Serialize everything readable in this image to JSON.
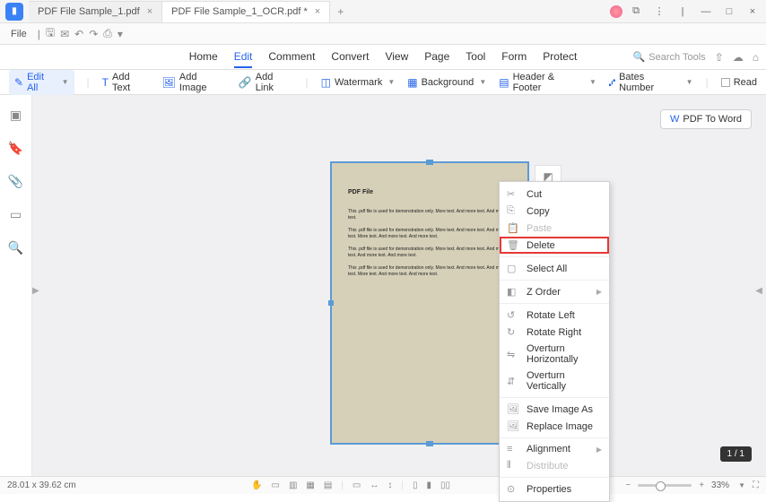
{
  "titlebar": {
    "tabs": [
      {
        "label": "PDF File Sample_1.pdf"
      },
      {
        "label": "PDF File Sample_1_OCR.pdf *"
      }
    ]
  },
  "toolbar1": {
    "file": "File"
  },
  "menubar": {
    "items": [
      "Home",
      "Edit",
      "Comment",
      "Convert",
      "View",
      "Page",
      "Tool",
      "Form",
      "Protect"
    ],
    "search_placeholder": "Search Tools"
  },
  "ribbon": {
    "edit_all": "Edit All",
    "add_text": "Add Text",
    "add_image": "Add Image",
    "add_link": "Add Link",
    "watermark": "Watermark",
    "background": "Background",
    "header_footer": "Header & Footer",
    "bates_number": "Bates Number",
    "read": "Read"
  },
  "canvas": {
    "pdf_to_word": "PDF To Word",
    "page_indicator": "1 / 1"
  },
  "page": {
    "title": "PDF File",
    "p1": "This .pdf file is used for demonstration only. More text. And more text. And more text.",
    "p2": "This .pdf file is used for demonstration only. More text. And more text. And more text. More text. And more text. And more text.",
    "p3": "This .pdf file is used for demonstration only. More text. And more text. And more text. And more text. And more text.",
    "p4": "This .pdf file is used for demonstration only. More text. And more text. And more text. More text. And more text. And more text."
  },
  "context_menu": {
    "cut": "Cut",
    "copy": "Copy",
    "paste": "Paste",
    "delete": "Delete",
    "select_all": "Select All",
    "z_order": "Z Order",
    "rotate_left": "Rotate Left",
    "rotate_right": "Rotate Right",
    "overturn_h": "Overturn Horizontally",
    "overturn_v": "Overturn Vertically",
    "save_image_as": "Save Image As",
    "replace_image": "Replace Image",
    "alignment": "Alignment",
    "distribute": "Distribute",
    "properties": "Properties"
  },
  "statusbar": {
    "dimensions": "28.01 x 39.62 cm",
    "zoom": "33%"
  }
}
